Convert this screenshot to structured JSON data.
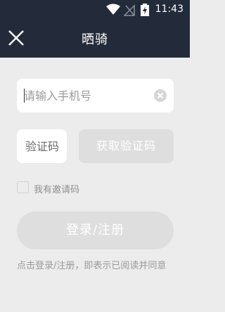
{
  "status_bar": {
    "time": "11:43",
    "icons": [
      "wifi-icon",
      "signal-icon",
      "battery-charging-icon"
    ]
  },
  "header": {
    "title": "晒骑",
    "close_icon": "close-icon"
  },
  "form": {
    "phone_placeholder": "请输入手机号",
    "phone_value": "",
    "clear_icon": "clear-circle-icon",
    "code_placeholder": "验证码",
    "code_value": "",
    "get_code_label": "获取验证码",
    "invite_label": "我有邀请码",
    "invite_checked": false,
    "submit_label": "登录/注册",
    "notice": "点击登录/注册，即表示已阅读并同意"
  },
  "colors": {
    "header_bg": "#232b3a",
    "page_bg": "#ececec",
    "disabled_button": "#dedede",
    "hint_text": "#9a9a9a"
  }
}
